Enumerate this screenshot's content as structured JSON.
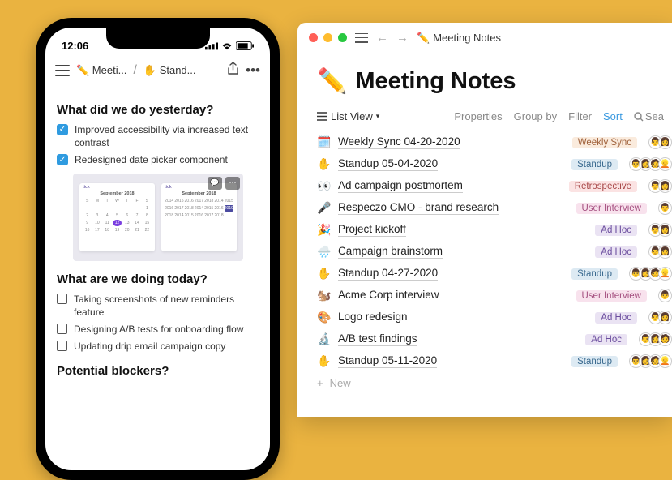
{
  "phone": {
    "time": "12:06",
    "breadcrumb1": "✏️ Meeti...",
    "breadcrumb2": "✋ Stand...",
    "h1": "What did we do yesterday?",
    "done1": "Improved accessibility via increased text contrast",
    "done2": "Redesigned date picker component",
    "cal_title": "September 2018",
    "h2": "What are we doing today?",
    "todo1": "Taking screenshots of new reminders feature",
    "todo2": "Designing A/B tests for onboarding flow",
    "todo3": "Updating drip email campaign copy",
    "h3": "Potential blockers?"
  },
  "window": {
    "tb_title": "Meeting Notes",
    "page_title": "Meeting Notes",
    "view_label": "List View",
    "ctl_properties": "Properties",
    "ctl_groupby": "Group by",
    "ctl_filter": "Filter",
    "ctl_sort": "Sort",
    "ctl_search_placeholder": "Sea",
    "new_label": "New",
    "tags": {
      "weekly_sync": "Weekly Sync",
      "standup": "Standup",
      "retrospective": "Retrospective",
      "user_interview": "User Interview",
      "ad_hoc": "Ad Hoc"
    },
    "rows": [
      {
        "emoji": "🗓️",
        "title": "Weekly Sync 04-20-2020",
        "tag": "weekly_sync",
        "tag_class": "tag-orange",
        "avatars": 2
      },
      {
        "emoji": "✋",
        "title": "Standup 05-04-2020",
        "tag": "standup",
        "tag_class": "tag-blue",
        "avatars": 4
      },
      {
        "emoji": "👀",
        "title": "Ad campaign postmortem",
        "tag": "retrospective",
        "tag_class": "tag-red",
        "avatars": 2
      },
      {
        "emoji": "🎤",
        "title": "Respeczo CMO - brand research",
        "tag": "user_interview",
        "tag_class": "tag-pink",
        "avatars": 1
      },
      {
        "emoji": "🎉",
        "title": "Project kickoff",
        "tag": "ad_hoc",
        "tag_class": "tag-purple",
        "avatars": 2
      },
      {
        "emoji": "🌧️",
        "title": "Campaign brainstorm",
        "tag": "ad_hoc",
        "tag_class": "tag-purple",
        "avatars": 2
      },
      {
        "emoji": "✋",
        "title": "Standup 04-27-2020",
        "tag": "standup",
        "tag_class": "tag-blue",
        "avatars": 4
      },
      {
        "emoji": "🐿️",
        "title": "Acme Corp interview",
        "tag": "user_interview",
        "tag_class": "tag-pink",
        "avatars": 1
      },
      {
        "emoji": "🎨",
        "title": "Logo redesign",
        "tag": "ad_hoc",
        "tag_class": "tag-purple",
        "avatars": 2
      },
      {
        "emoji": "🔬",
        "title": "A/B test findings",
        "tag": "ad_hoc",
        "tag_class": "tag-purple",
        "avatars": 3
      },
      {
        "emoji": "✋",
        "title": "Standup 05-11-2020",
        "tag": "standup",
        "tag_class": "tag-blue",
        "avatars": 4
      }
    ]
  }
}
